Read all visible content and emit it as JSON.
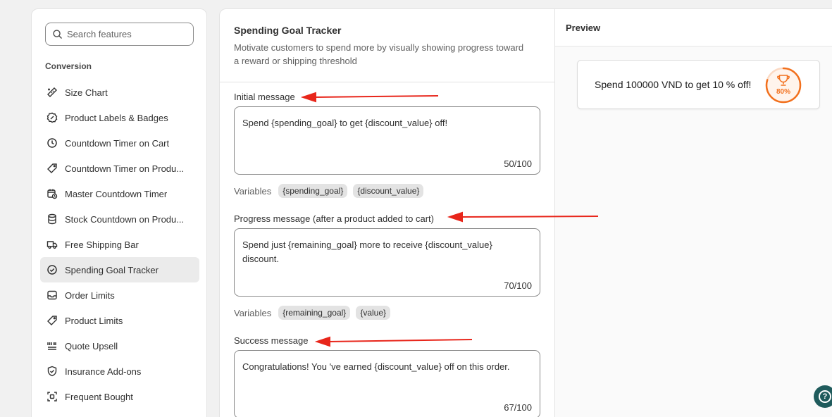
{
  "sidebar": {
    "search_placeholder": "Search features",
    "section_title": "Conversion",
    "items": [
      {
        "label": "Size Chart",
        "icon": "ruler-icon"
      },
      {
        "label": "Product Labels & Badges",
        "icon": "badge-icon"
      },
      {
        "label": "Countdown Timer on Cart",
        "icon": "clock-icon"
      },
      {
        "label": "Countdown Timer on Produ...",
        "icon": "tag-timer-icon"
      },
      {
        "label": "Master Countdown Timer",
        "icon": "calendar-clock-icon"
      },
      {
        "label": "Stock Countdown on Produ...",
        "icon": "database-icon"
      },
      {
        "label": "Free Shipping Bar",
        "icon": "truck-icon"
      },
      {
        "label": "Spending Goal Tracker",
        "icon": "check-circle-icon"
      },
      {
        "label": "Order Limits",
        "icon": "inbox-icon"
      },
      {
        "label": "Product Limits",
        "icon": "tag-icon"
      },
      {
        "label": "Quote Upsell",
        "icon": "list-icon"
      },
      {
        "label": "Insurance Add-ons",
        "icon": "shield-check-icon"
      },
      {
        "label": "Frequent Bought",
        "icon": "bundle-icon"
      }
    ],
    "active_index": 7
  },
  "settings": {
    "title": "Spending Goal Tracker",
    "description": "Motivate customers to spend more by visually showing progress toward a reward or shipping threshold",
    "initial": {
      "label": "Initial message",
      "value": "Spend {spending_goal} to get {discount_value} off!",
      "count": "50/100",
      "variables_label": "Variables",
      "variables": [
        "{spending_goal}",
        "{discount_value}"
      ]
    },
    "progress": {
      "label": "Progress message (after a product added to cart)",
      "value": "Spend just {remaining_goal} more to receive {discount_value} discount.",
      "count": "70/100",
      "variables_label": "Variables",
      "variables": [
        "{remaining_goal}",
        "{value}"
      ]
    },
    "success": {
      "label": "Success message",
      "value": "Congratulations! You 've earned {discount_value} off on this order.",
      "count": "67/100"
    }
  },
  "preview": {
    "title": "Preview",
    "text": "Spend 100000 VND to get 10 % off!",
    "percent_label": "80%",
    "progress": 0.8,
    "accent_color": "#f2701d"
  },
  "help_icon": "help-icon",
  "annotation_color": "#e8261b"
}
